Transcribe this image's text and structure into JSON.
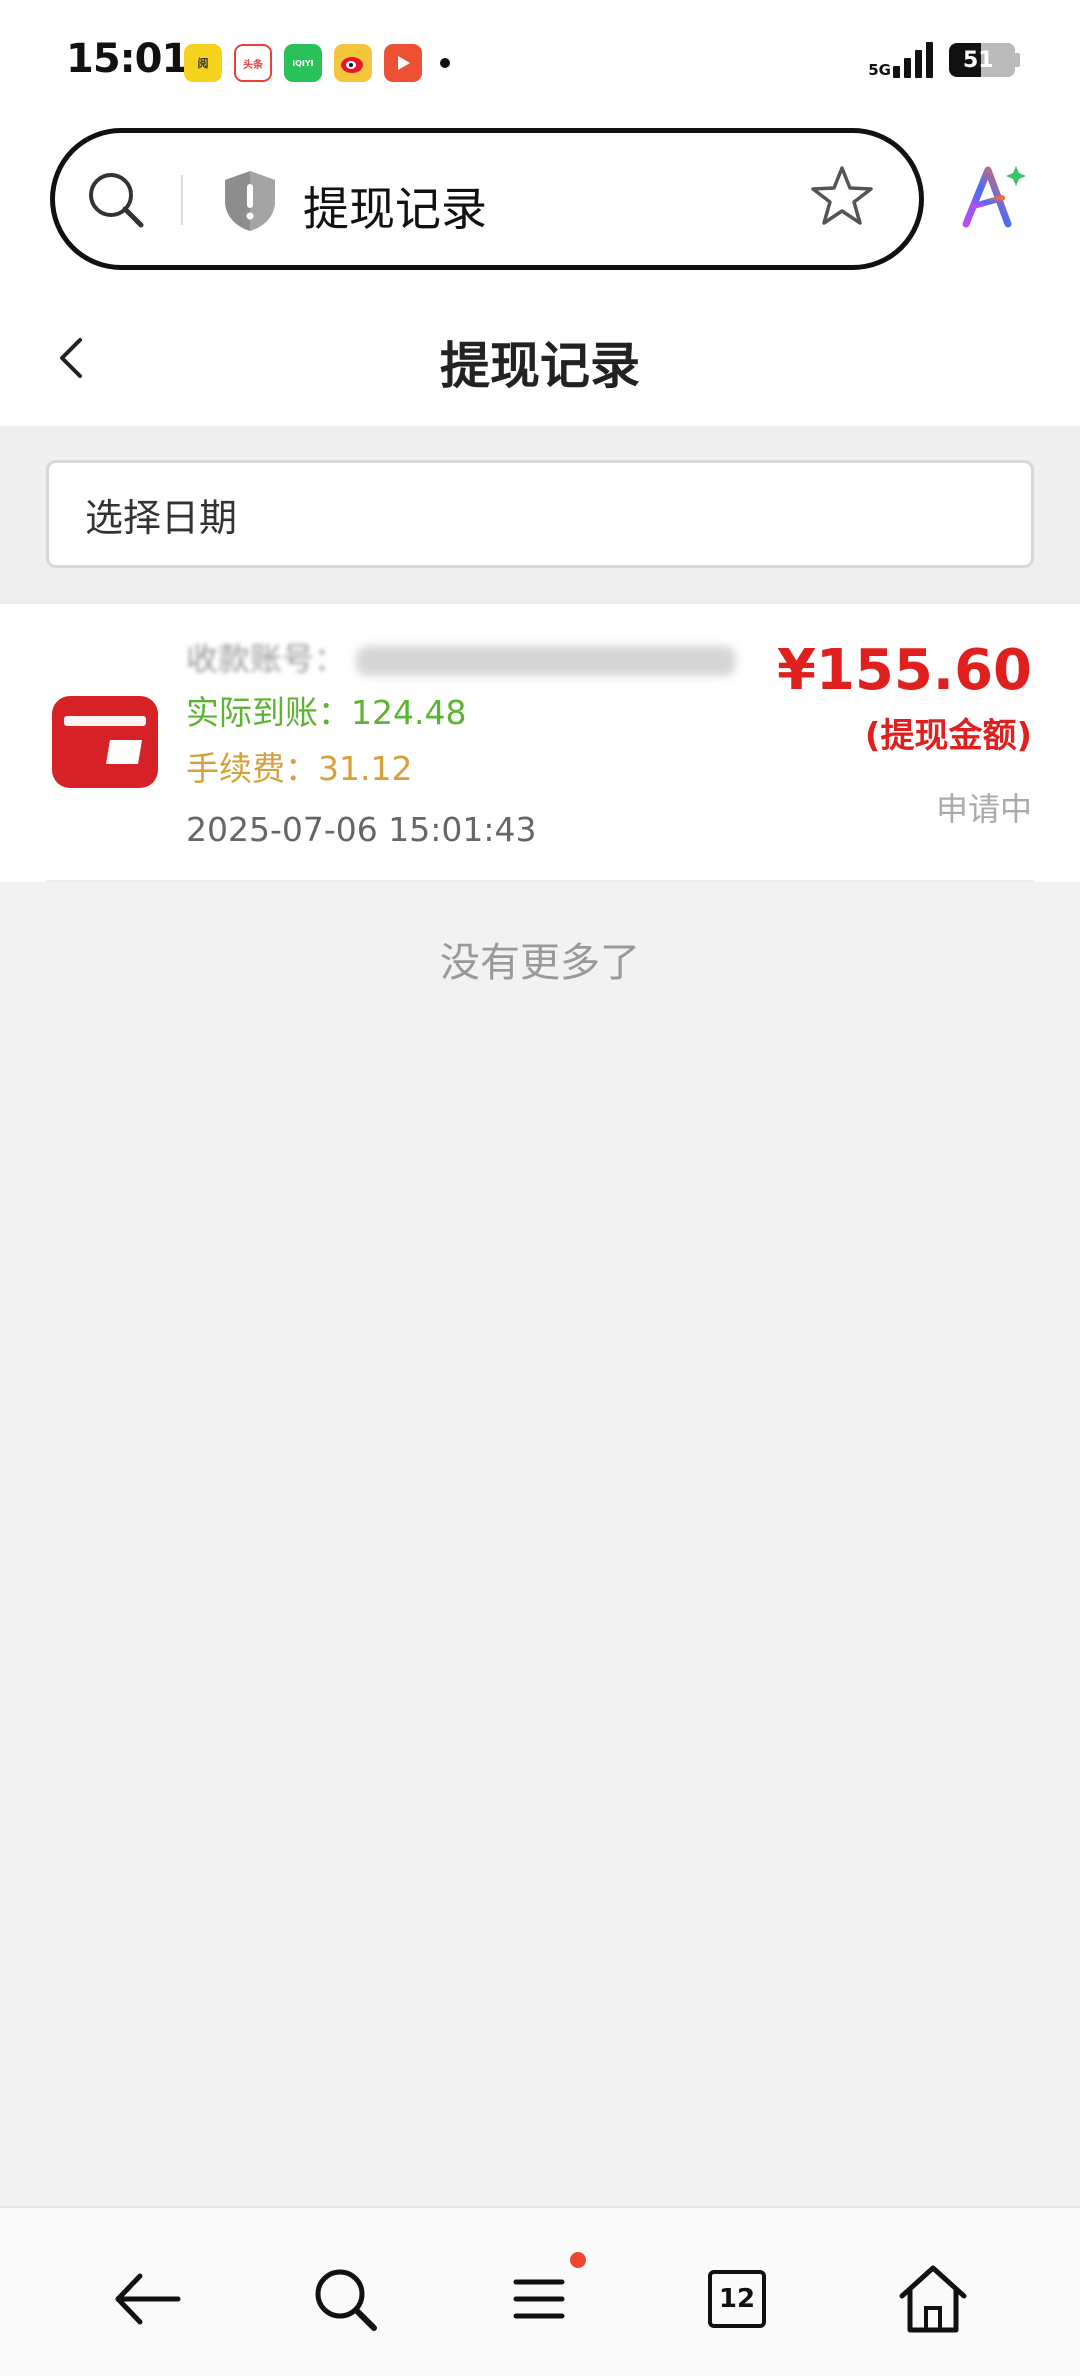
{
  "status_bar": {
    "time": "15:01",
    "network": "5G",
    "battery": "51",
    "notification_icons": [
      {
        "name": "app-icon-1",
        "label": "阅",
        "color": "#f4d21e"
      },
      {
        "name": "toutiao-icon",
        "label": "头条",
        "color": "#e8413a"
      },
      {
        "name": "iqiyi-icon",
        "label": "iQIYI",
        "color": "#28c15a"
      },
      {
        "name": "weibo-icon",
        "label": "",
        "color": "#f5c53b"
      },
      {
        "name": "video-app-icon",
        "label": "",
        "color": "#ee5033"
      }
    ]
  },
  "browser": {
    "url_text": "提现记录"
  },
  "header": {
    "title": "提现记录"
  },
  "filter": {
    "date_placeholder": "选择日期"
  },
  "record": {
    "account_label": "收款账号：",
    "actual": "实际到账：124.48",
    "fee": "手续费：31.12",
    "time": "2025-07-06 15:01:43",
    "amount": "¥155.60",
    "amount_label": "(提现金额)",
    "status": "申请中"
  },
  "footer": {
    "no_more": "没有更多了"
  },
  "bottom_nav": {
    "tab_count": "12"
  },
  "colors": {
    "amount": "#e0201f",
    "actual": "#5cb531",
    "fee": "#d7a03b"
  }
}
